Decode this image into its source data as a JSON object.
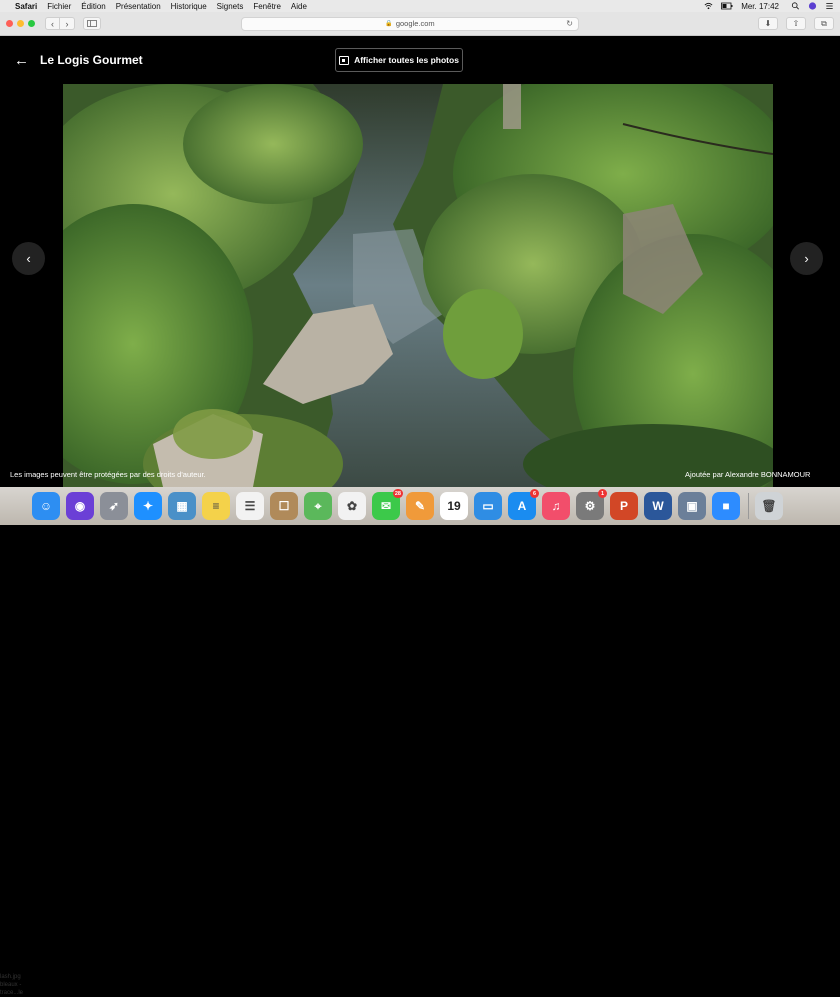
{
  "menubar": {
    "app": "Safari",
    "items": [
      "Fichier",
      "Édition",
      "Présentation",
      "Historique",
      "Signets",
      "Fenêtre",
      "Aide"
    ],
    "clock": "Mer. 17:42"
  },
  "toolbar": {
    "url": "google.com"
  },
  "viewer": {
    "back_arrow": "←",
    "title": "Le Logis Gourmet",
    "all_photos_label": "Afficher toutes les photos",
    "prev_arrow": "‹",
    "next_arrow": "›",
    "copyright_notice": "Les images peuvent être protégées par des droits d'auteur.",
    "attribution": "Ajoutée par Alexandre BONNAMOUR"
  },
  "desktop": {
    "files": [
      "lash.jpg",
      "bleaux -",
      "trace...le"
    ]
  },
  "dock": {
    "items": [
      {
        "name": "finder",
        "color": "#2d8ef2",
        "glyph": "☺"
      },
      {
        "name": "siri",
        "color": "#6b3fd6",
        "glyph": "◉"
      },
      {
        "name": "launchpad",
        "color": "#8b8f98",
        "glyph": "➶"
      },
      {
        "name": "safari",
        "color": "#1e90ff",
        "glyph": "✦"
      },
      {
        "name": "preview",
        "color": "#4a90c8",
        "glyph": "▦"
      },
      {
        "name": "notes",
        "color": "#f4d24a",
        "glyph": "≡"
      },
      {
        "name": "reminders",
        "color": "#f2f2f2",
        "glyph": "☰"
      },
      {
        "name": "contacts",
        "color": "#b08a5a",
        "glyph": "☐"
      },
      {
        "name": "maps",
        "color": "#5bb85b",
        "glyph": "⌖"
      },
      {
        "name": "photos",
        "color": "#f2f2f2",
        "glyph": "✿"
      },
      {
        "name": "messages",
        "color": "#3cc94a",
        "glyph": "✉",
        "badge": "28"
      },
      {
        "name": "pages",
        "color": "#f09a3a",
        "glyph": "✎"
      },
      {
        "name": "calendar",
        "color": "#ffffff",
        "glyph": "19"
      },
      {
        "name": "keynote",
        "color": "#2f8de4",
        "glyph": "▭"
      },
      {
        "name": "app-store",
        "color": "#1a8cf0",
        "glyph": "A",
        "badge": "6"
      },
      {
        "name": "music",
        "color": "#f24e6b",
        "glyph": "♫"
      },
      {
        "name": "system-preferences",
        "color": "#7a7a7a",
        "glyph": "⚙",
        "badge": "1"
      },
      {
        "name": "powerpoint",
        "color": "#d24726",
        "glyph": "P"
      },
      {
        "name": "word",
        "color": "#2b579a",
        "glyph": "W"
      },
      {
        "name": "image-capture",
        "color": "#6b7f99",
        "glyph": "▣"
      },
      {
        "name": "zoom",
        "color": "#2d8cff",
        "glyph": "■"
      },
      {
        "name": "trash",
        "color": "#cfd3d6",
        "glyph": "🗑"
      }
    ]
  }
}
